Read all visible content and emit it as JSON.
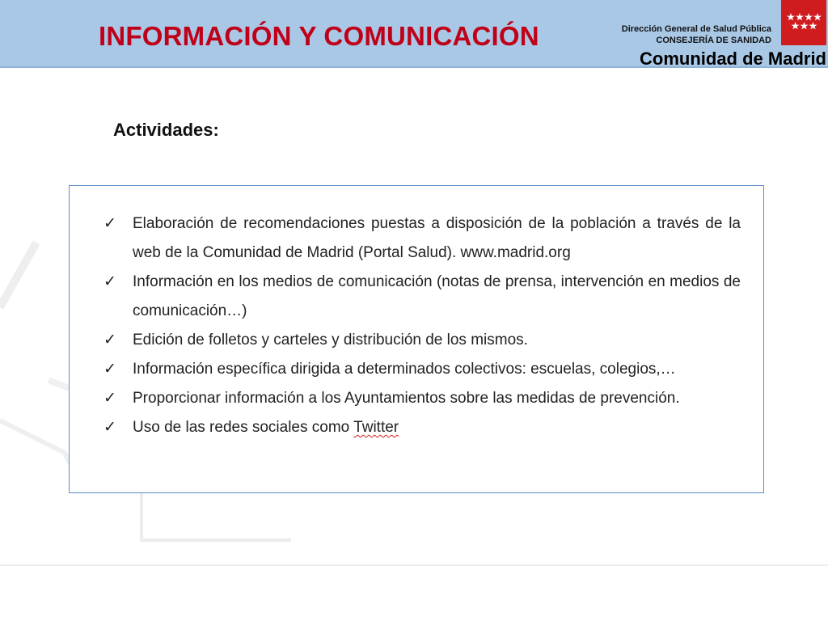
{
  "header": {
    "title": "INFORMACIÓN Y COMUNICACIÓN",
    "org_line1": "Dirección General de Salud Pública",
    "org_line2": "CONSEJERÍA DE SANIDAD",
    "org_line3": "Comunidad de Madrid",
    "band_color": "#a9c8e6",
    "title_color": "#c00018",
    "flag_color": "#d01c1f",
    "flag_icon": "madrid-stars-flag-icon"
  },
  "main": {
    "section_label": "Actividades:",
    "bullet_icon": "checkmark-icon",
    "bullet_glyph": "✓",
    "box_border_color": "#5b8cc8",
    "items": [
      "Elaboración de recomendaciones puestas a disposición de la población a través de la web de la Comunidad de Madrid (Portal Salud). www.madrid.org",
      "Información en los medios de comunicación (notas de prensa, intervención en medios de comunicación…)",
      "Edición de folletos y carteles y distribución de los mismos.",
      "Información específica dirigida a determinados colectivos: escuelas, colegios,…",
      "Proporcionar información a los Ayuntamientos sobre las medidas de prevención."
    ],
    "last_item_prefix": "Uso de las redes sociales como ",
    "last_item_word": "Twitter"
  }
}
